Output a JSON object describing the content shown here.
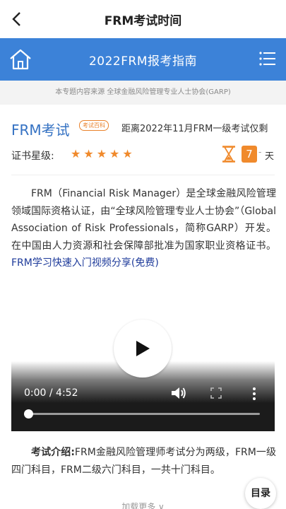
{
  "header": {
    "title": "FRM考试时间"
  },
  "banner": {
    "title": "2022FRM报考指南"
  },
  "source": {
    "text": "本专题内容来源 全球金融风险管理专业人士协会(GARP)"
  },
  "exam": {
    "title": "FRM考试",
    "tag": "考试百科",
    "countdown": "距离2022年11月FRM一级考试仅剩",
    "star_label": "证书星级:",
    "stars": 5,
    "days": "7",
    "days_dash": "-",
    "days_unit": "天"
  },
  "intro": {
    "text": "FRM（Financial Risk Manager）是全球金融风险管理领域国际资格认证，由“全球风险管理专业人士协会”（Global Association of Risk Professionals，简称GARP）开发。在中国由人力资源和社会保障部批准为国家职业资格证书。",
    "link": "FRM学习快速入门视频分享(免费)"
  },
  "video": {
    "time": "0:00 / 4:52",
    "progress": 0
  },
  "exam_intro": {
    "label": "考试介绍:",
    "text": "FRM金融风险管理师考试分为两级，FRM一级四门科目，FRM二级六门科目，一共十门科目。"
  },
  "footer": {
    "load_more": "加载更多 ∨",
    "toc": "目录"
  },
  "colors": {
    "accent": "#3c82d8",
    "orange": "#f08a2c",
    "link": "#1d3a9a"
  }
}
